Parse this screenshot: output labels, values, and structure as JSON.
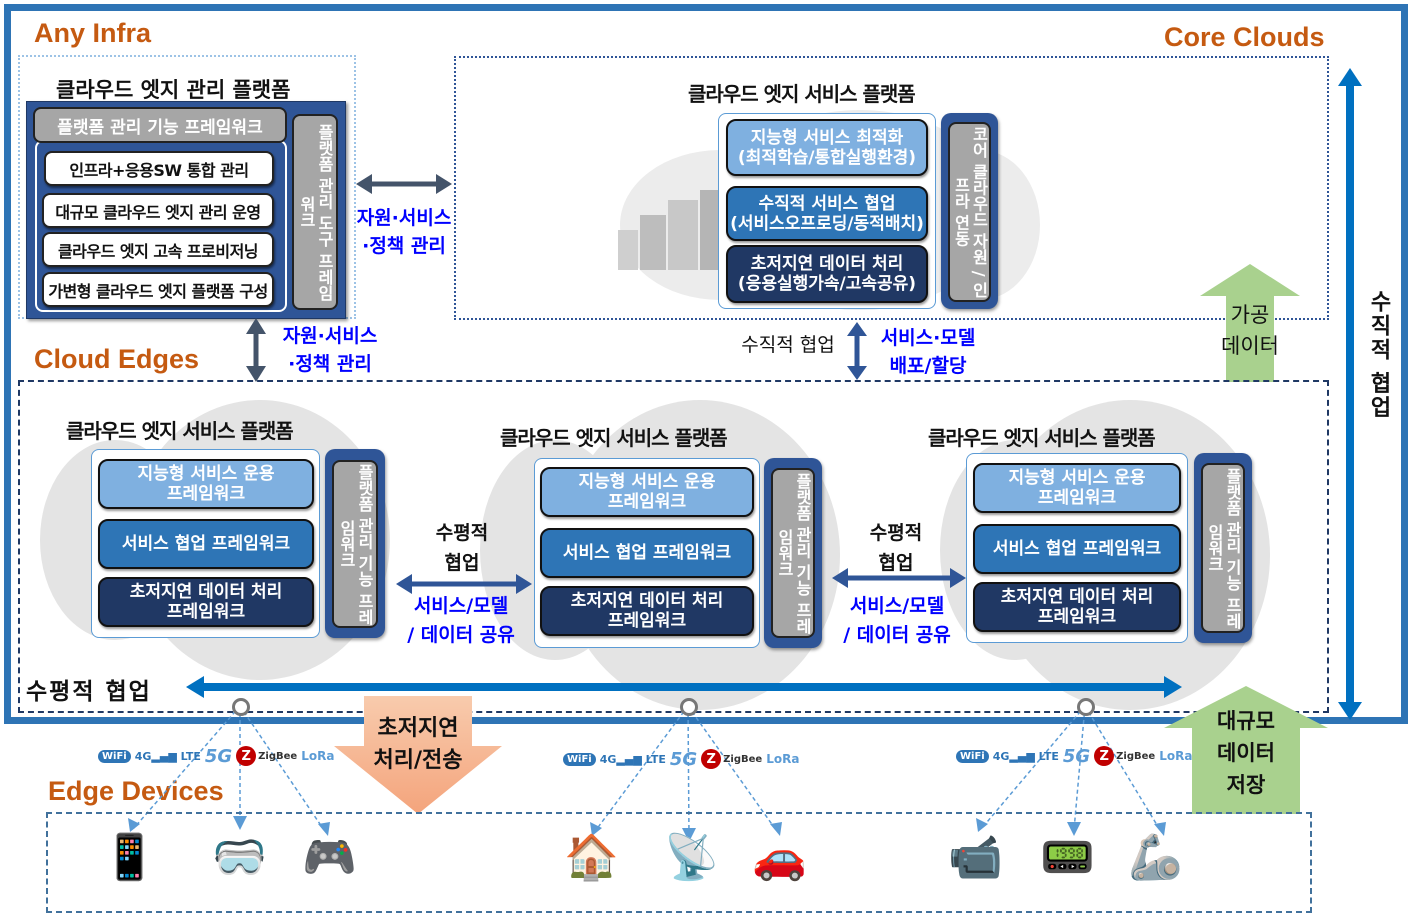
{
  "sections": {
    "any_infra": "Any Infra",
    "core_clouds": "Core Clouds",
    "cloud_edges": "Cloud Edges",
    "edge_devices": "Edge Devices"
  },
  "management_platform": {
    "title": "클라우드 엣지 관리 플랫폼",
    "framework_header": "플랫폼 관리 기능 프레임워크",
    "items": [
      "인프라+응용SW 통합 관리",
      "대규모 클라우드 엣지 관리 운영",
      "클라우드 엣지 고속 프로비저닝",
      "가변형 클라우드 엣지 플랫폼 구성"
    ],
    "side_tool": "플랫폼 관리 도구 프레임워크"
  },
  "core_platform": {
    "title": "클라우드 엣지 서비스 플랫폼",
    "layers": [
      {
        "line1": "지능형 서비스 최적화",
        "line2": "(최적학습/통합실행환경)"
      },
      {
        "line1": "수직적 서비스 협업",
        "line2": "(서비스오프로딩/동적배치)"
      },
      {
        "line1": "초저지연 데이터 처리",
        "line2": "(응용실행가속/고속공유)"
      }
    ],
    "side": "코어 클라우드 자원 / 인프라 연동"
  },
  "edge_platforms": [
    {
      "title": "클라우드 엣지 서비스 플랫폼",
      "layers": [
        {
          "line1": "지능형 서비스 운용",
          "line2": "프레임워크"
        },
        {
          "line1": "서비스 협업 프레임워크",
          "line2": ""
        },
        {
          "line1": "초저지연 데이터 처리",
          "line2": "프레임워크"
        }
      ],
      "side": "플랫폼 관리 기능 프레임워크"
    },
    {
      "title": "클라우드 엣지 서비스 플랫폼",
      "layers": [
        {
          "line1": "지능형 서비스 운용",
          "line2": "프레임워크"
        },
        {
          "line1": "서비스 협업 프레임워크",
          "line2": ""
        },
        {
          "line1": "초저지연 데이터 처리",
          "line2": "프레임워크"
        }
      ],
      "side": "플랫폼 관리 기능 프레임워크"
    },
    {
      "title": "클라우드 엣지 서비스 플랫폼",
      "layers": [
        {
          "line1": "지능형 서비스 운용",
          "line2": "프레임워크"
        },
        {
          "line1": "서비스 협업 프레임워크",
          "line2": ""
        },
        {
          "line1": "초저지연 데이터 처리",
          "line2": "프레임워크"
        }
      ],
      "side": "플랫폼 관리 기능 프레임워크"
    }
  ],
  "labels": {
    "mgmt_to_core_1": "자원·서비스",
    "mgmt_to_core_2": "·정책 관리",
    "mgmt_to_edge_1": "자원·서비스",
    "mgmt_to_edge_2": "·정책 관리",
    "vertical_collab": "수직적 협업",
    "deploy_1": "서비스·모델",
    "deploy_2": "배포/할당",
    "horiz_1a": "수평적",
    "horiz_1b": "협업",
    "share_1a": "서비스/모델",
    "share_1b": "/ 데이터 공유",
    "horiz_2a": "수평적",
    "horiz_2b": "협업",
    "share_2a": "서비스/모델",
    "share_2b": "/ 데이터 공유",
    "horizontal_bar": "수평적 협업",
    "vertical_bar": "수직적 협업",
    "processed_data_1": "가공",
    "processed_data_2": "데이터",
    "low_latency_1": "초저지연",
    "low_latency_2": "처리/전송",
    "large_data_1": "대규모",
    "large_data_2": "데이터",
    "large_data_3": "저장"
  },
  "protocols": {
    "wifi": "WiFi",
    "fourg": "4G",
    "lte": "LTE",
    "fiveg": "5G",
    "zigbee": "ZigBee",
    "lora": "LoRa"
  },
  "devices": [
    {
      "name": "smartphone",
      "glyph": "📱"
    },
    {
      "name": "vr-headset",
      "glyph": "🥽"
    },
    {
      "name": "game-console",
      "glyph": "🎮"
    },
    {
      "name": "smart-home",
      "glyph": "🏠"
    },
    {
      "name": "robot-sensor",
      "glyph": "📡"
    },
    {
      "name": "connected-cars",
      "glyph": "🚗"
    },
    {
      "name": "cctv-camera",
      "glyph": "📹"
    },
    {
      "name": "tablet",
      "glyph": "📟"
    },
    {
      "name": "robot-arms",
      "glyph": "🦾"
    }
  ],
  "colors": {
    "frame": "#2e74b5",
    "section_title": "#c55a11",
    "layer_light": "#7fb0e0",
    "layer_mid": "#2e75b6",
    "layer_dark": "#203864",
    "blue_text": "#0000ff",
    "green_arrow": "#a9d18e",
    "orange_arrow": "#f4b183"
  }
}
